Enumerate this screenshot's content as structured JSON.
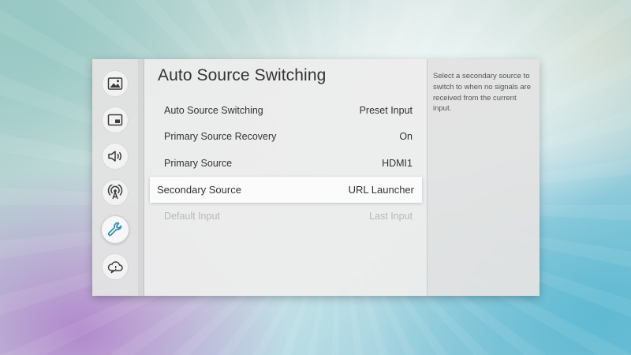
{
  "sidebar": {
    "items": [
      {
        "icon": "picture-icon"
      },
      {
        "icon": "screen-layout-icon"
      },
      {
        "icon": "sound-icon"
      },
      {
        "icon": "broadcast-icon"
      },
      {
        "icon": "wrench-icon",
        "selected": true
      },
      {
        "icon": "cloud-support-icon"
      }
    ]
  },
  "main": {
    "title": "Auto Source Switching",
    "items": [
      {
        "label": "Auto Source Switching",
        "value": "Preset Input"
      },
      {
        "label": "Primary Source Recovery",
        "value": "On"
      },
      {
        "label": "Primary Source",
        "value": "HDMI1"
      },
      {
        "label": "Secondary Source",
        "value": "URL Launcher",
        "focused": true
      },
      {
        "label": "Default Input",
        "value": "Last Input",
        "disabled": true
      }
    ]
  },
  "info": {
    "text": "Select a secondary source to switch to when no signals are received from the current input."
  },
  "colors": {
    "accent": "#2f8fb0",
    "text": "#333333",
    "disabled_text": "#b8b8b8"
  }
}
